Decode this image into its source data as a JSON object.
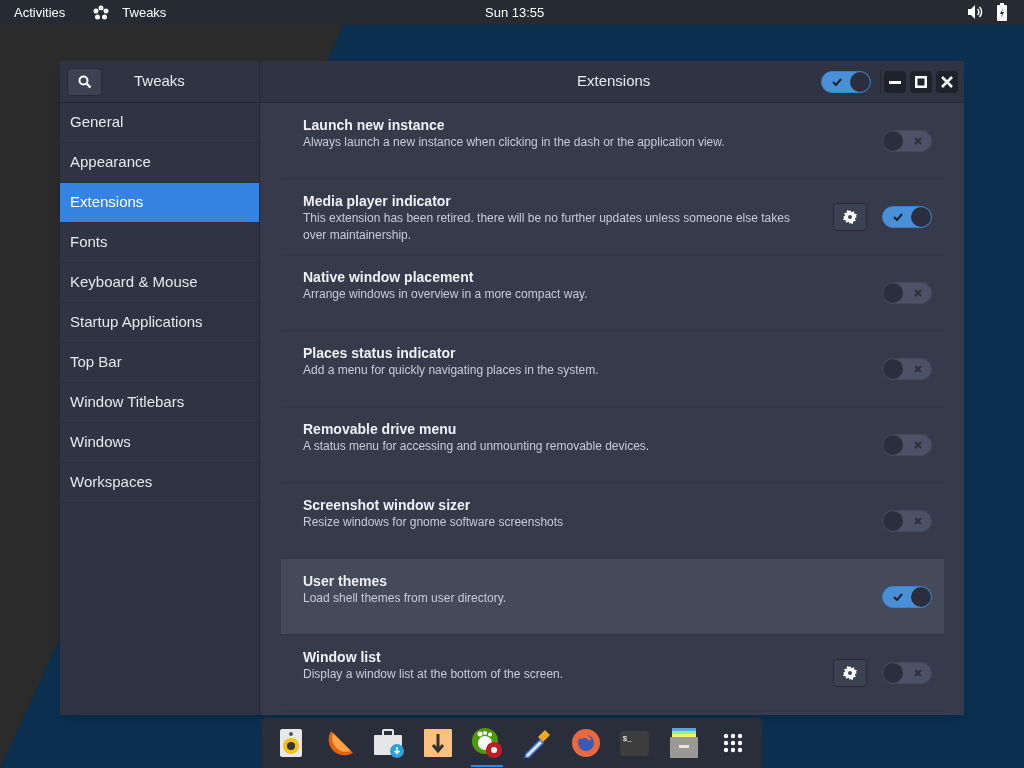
{
  "top_bar": {
    "activities": "Activities",
    "app_name": "Tweaks",
    "clock": "Sun 13:55"
  },
  "window": {
    "sidebar_title": "Tweaks",
    "title": "Extensions",
    "header_switch_on": true
  },
  "sidebar": {
    "items": [
      {
        "label": "General",
        "selected": false
      },
      {
        "label": "Appearance",
        "selected": false
      },
      {
        "label": "Extensions",
        "selected": true
      },
      {
        "label": "Fonts",
        "selected": false
      },
      {
        "label": "Keyboard & Mouse",
        "selected": false
      },
      {
        "label": "Startup Applications",
        "selected": false
      },
      {
        "label": "Top Bar",
        "selected": false
      },
      {
        "label": "Window Titlebars",
        "selected": false
      },
      {
        "label": "Windows",
        "selected": false
      },
      {
        "label": "Workspaces",
        "selected": false
      }
    ]
  },
  "extensions": [
    {
      "title": "Launch new instance",
      "description": "Always launch a new instance when clicking in the dash or the application view.",
      "settings": false,
      "on": false,
      "highlighted": false
    },
    {
      "title": "Media player indicator",
      "description": "This extension has been retired. there will be no further updates unless someone else takes over maintainership.",
      "settings": true,
      "on": true,
      "highlighted": false
    },
    {
      "title": "Native window placement",
      "description": "Arrange windows in overview in a more compact way.",
      "settings": false,
      "on": false,
      "highlighted": false
    },
    {
      "title": "Places status indicator",
      "description": "Add a menu for quickly navigating places in the system.",
      "settings": false,
      "on": false,
      "highlighted": false
    },
    {
      "title": "Removable drive menu",
      "description": "A status menu for accessing and unmounting removable devices.",
      "settings": false,
      "on": false,
      "highlighted": false
    },
    {
      "title": "Screenshot window sizer",
      "description": "Resize windows for gnome software screenshots",
      "settings": false,
      "on": false,
      "highlighted": false
    },
    {
      "title": "User themes",
      "description": "Load shell themes from user directory.",
      "settings": false,
      "on": true,
      "highlighted": true
    },
    {
      "title": "Window list",
      "description": "Display a window list at the bottom of the screen.",
      "settings": true,
      "on": false,
      "highlighted": false
    }
  ],
  "dock": [
    {
      "kind": "speaker",
      "running": false
    },
    {
      "kind": "orange",
      "running": false
    },
    {
      "kind": "briefcase",
      "running": false
    },
    {
      "kind": "download",
      "running": false
    },
    {
      "kind": "foot",
      "running": true
    },
    {
      "kind": "dropper",
      "running": false
    },
    {
      "kind": "browser",
      "running": false
    },
    {
      "kind": "terminal",
      "running": false,
      "prompt": "$_"
    },
    {
      "kind": "files",
      "running": false
    },
    {
      "kind": "grid",
      "running": false
    }
  ]
}
